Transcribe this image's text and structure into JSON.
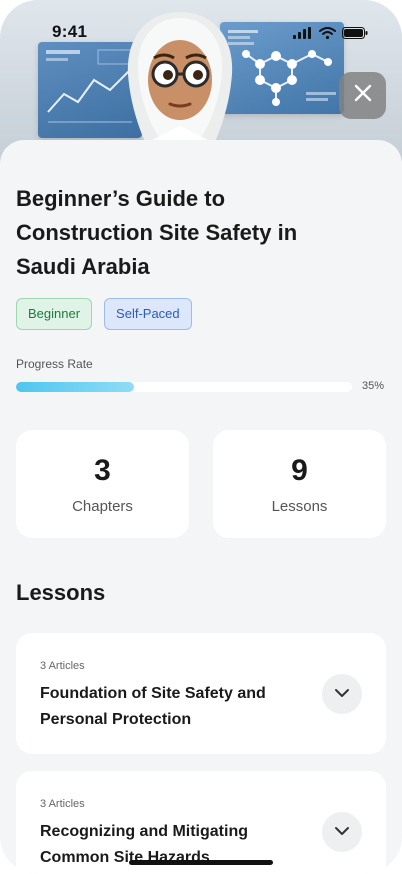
{
  "status_bar": {
    "time": "9:41"
  },
  "course": {
    "title": "Beginner’s Guide to Construction Site Safety in Saudi Arabia",
    "tags": [
      "Beginner",
      "Self-Paced"
    ]
  },
  "progress": {
    "label": "Progress Rate",
    "value": 0.35,
    "display": "35%"
  },
  "stats": [
    {
      "number": "3",
      "label": "Chapters"
    },
    {
      "number": "9",
      "label": "Lessons"
    }
  ],
  "lessons_section": {
    "title": "Lessons",
    "items": [
      {
        "meta": "3 Articles",
        "title": "Foundation of Site Safety and Personal Protection"
      },
      {
        "meta": "3 Articles",
        "title": "Recognizing and Mitigating Common Site Hazards"
      }
    ]
  },
  "colors": {
    "progress_fill": "#4fc6f0",
    "beginner_tag": "#1e7c3c",
    "selfpaced_tag": "#2d5bb8"
  },
  "icons": {
    "close": "close-icon",
    "chevron": "chevron-down-icon",
    "signal": "signal-icon",
    "wifi": "wifi-icon",
    "battery": "battery-icon"
  }
}
